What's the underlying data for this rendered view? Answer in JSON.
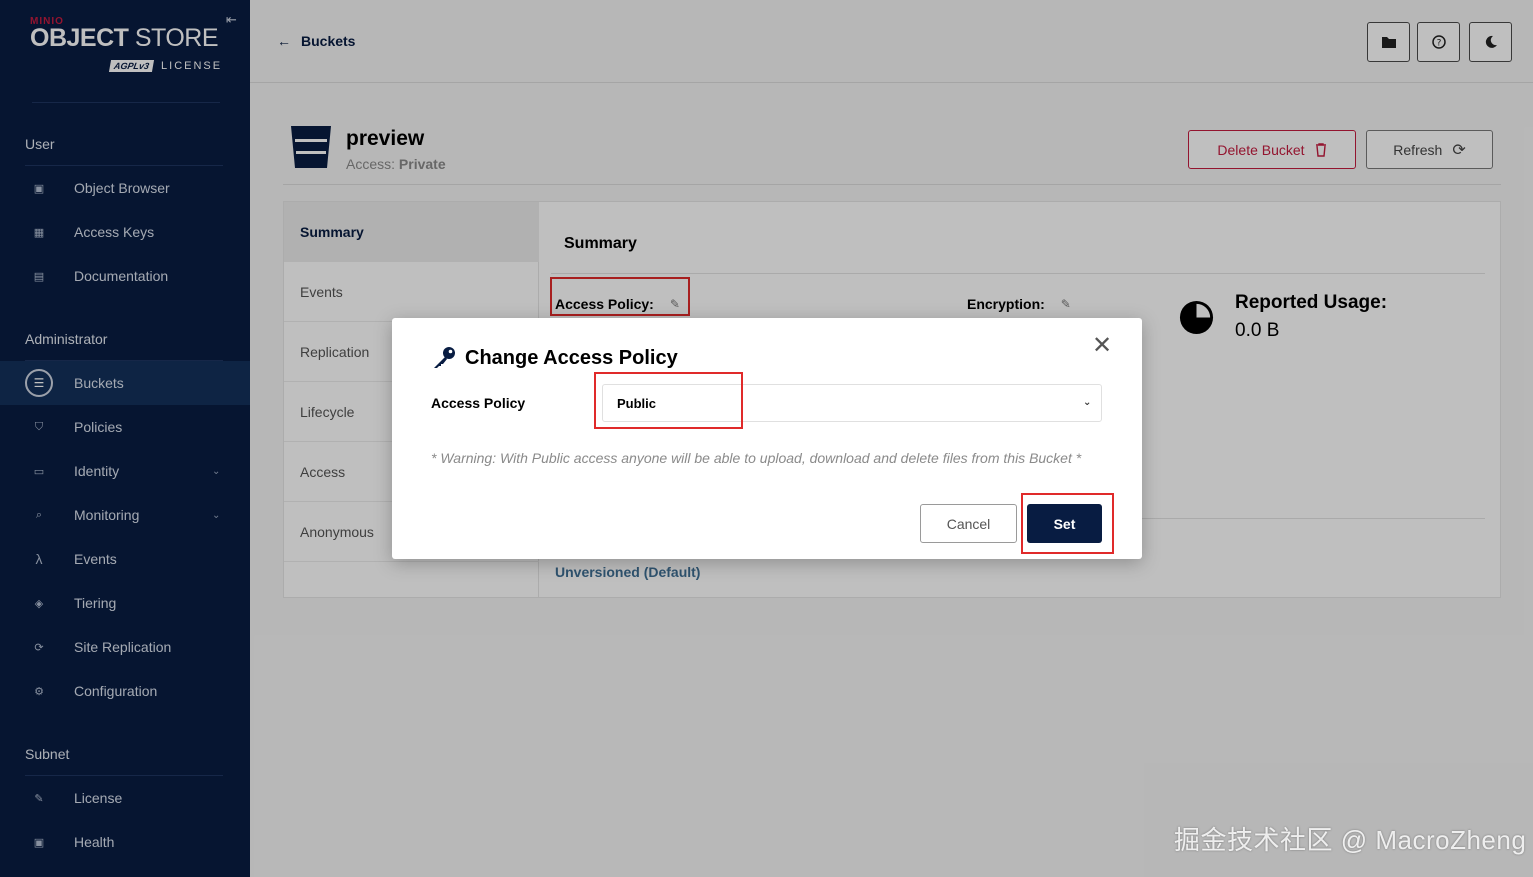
{
  "brand": {
    "minio": "MINIO",
    "object": "OBJECT",
    "store": " STORE",
    "agpl": "AGPLv3",
    "license": "LICENSE"
  },
  "sidebar": {
    "sections": [
      {
        "title": "User"
      },
      {
        "title": "Administrator"
      },
      {
        "title": "Subnet"
      }
    ],
    "items": [
      {
        "label": "Object Browser",
        "icon": "object-browser-icon"
      },
      {
        "label": "Access Keys",
        "icon": "access-keys-icon"
      },
      {
        "label": "Documentation",
        "icon": "documentation-icon"
      },
      {
        "label": "Buckets",
        "icon": "buckets-icon",
        "active": true
      },
      {
        "label": "Policies",
        "icon": "policies-icon"
      },
      {
        "label": "Identity",
        "icon": "identity-icon",
        "expandable": true
      },
      {
        "label": "Monitoring",
        "icon": "monitoring-icon",
        "expandable": true
      },
      {
        "label": "Events",
        "icon": "lambda-icon"
      },
      {
        "label": "Tiering",
        "icon": "tiering-icon"
      },
      {
        "label": "Site Replication",
        "icon": "site-replication-icon"
      },
      {
        "label": "Configuration",
        "icon": "gear-icon"
      },
      {
        "label": "License",
        "icon": "license-icon"
      },
      {
        "label": "Health",
        "icon": "health-icon"
      }
    ]
  },
  "header": {
    "back_label": "Buckets"
  },
  "bucket": {
    "name": "preview",
    "access_prefix": "Access: ",
    "access_value": "Private",
    "delete_label": "Delete Bucket",
    "refresh_label": "Refresh"
  },
  "tabs": [
    {
      "label": "Summary",
      "active": true
    },
    {
      "label": "Events"
    },
    {
      "label": "Replication"
    },
    {
      "label": "Lifecycle"
    },
    {
      "label": "Access"
    },
    {
      "label": "Anonymous"
    }
  ],
  "summary": {
    "title": "Summary",
    "access_policy_label": "Access Policy:",
    "encryption_label": "Encryption:",
    "usage_title": "Reported Usage:",
    "usage_value": "0.0 B",
    "versioning_value": "Unversioned (Default)"
  },
  "modal": {
    "title": "Change Access Policy",
    "field_label": "Access Policy",
    "selected_value": "Public",
    "warning": "* Warning: With Public access anyone will be able to upload, download and delete files from this Bucket *",
    "cancel_label": "Cancel",
    "set_label": "Set"
  },
  "watermark": "掘金技术社区 @ MacroZheng",
  "colors": {
    "sidebar_bg": "#081c42",
    "accent_red": "#c51b3f",
    "primary": "#081c42",
    "highlight": "#e02a2a"
  }
}
